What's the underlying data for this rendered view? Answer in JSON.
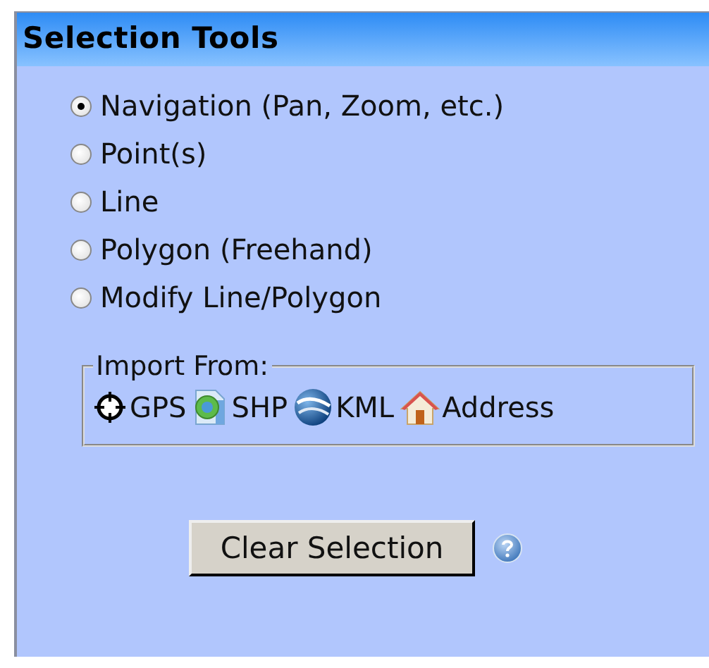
{
  "panel": {
    "title": "Selection Tools"
  },
  "options": [
    {
      "label": "Navigation (Pan, Zoom, etc.)",
      "selected": true
    },
    {
      "label": "Point(s)",
      "selected": false
    },
    {
      "label": "Line",
      "selected": false
    },
    {
      "label": "Polygon (Freehand)",
      "selected": false
    },
    {
      "label": "Modify Line/Polygon",
      "selected": false
    }
  ],
  "import": {
    "legend": "Import From:",
    "sources": [
      {
        "kind": "gps",
        "label": "GPS"
      },
      {
        "kind": "shp",
        "label": "SHP"
      },
      {
        "kind": "kml",
        "label": "KML"
      },
      {
        "kind": "address",
        "label": "Address"
      }
    ]
  },
  "clear_button": "Clear Selection"
}
